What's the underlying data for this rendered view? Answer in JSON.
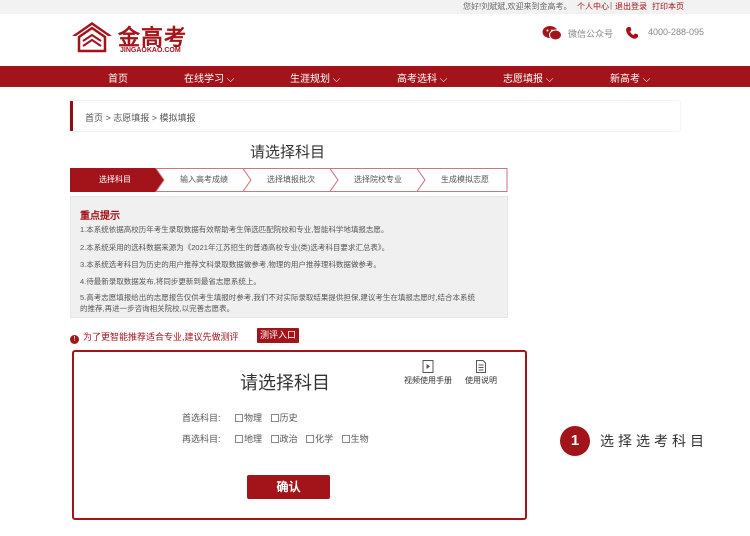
{
  "topbar": {
    "greeting": "您好!刘斌斌,欢迎来到金高考。",
    "user_center": "个人中心",
    "separator": "|",
    "logout": "退出登录",
    "print": "打印本页"
  },
  "logo": {
    "name": "金高考",
    "url": "JINGAOKAO.COM"
  },
  "contact": {
    "wechat": "微信公众号",
    "phone": "4000-288-095"
  },
  "nav": [
    {
      "label": "首页"
    },
    {
      "label": "在线学习 ⌵"
    },
    {
      "label": "生涯规划 ⌵"
    },
    {
      "label": "高考选科 ⌵"
    },
    {
      "label": "志愿填报 ⌵"
    },
    {
      "label": "新高考 ⌵"
    }
  ],
  "breadcrumb": "首页 > 志愿填报 > 模拟填报",
  "page_title": "请选择科目",
  "steps": [
    "选择科目",
    "输入高考成绩",
    "选择填报批次",
    "选择院校专业",
    "生成模拟志愿"
  ],
  "notice": {
    "heading": "重点提示",
    "lines": [
      "1.本系统依据高校历年考生录取数据有效帮助考生筛选匹配院校和专业,智能科学地填报志愿。",
      "2.本系统采用的选科数据来源为《2021年江苏招生的普通高校专业(类)选考科目要求汇总表》。",
      "3.本系统选考科目为历史的用户推荐文科录取数据做参考,物理的用户推荐理科数据做参考。",
      "4.待最新录取数据发布,将同步更新到最省志愿系统上。",
      "5.高考志愿填报给出的志愿报告仅供考生填报时参考,我们不对实际录取结果提供担保,建议考生在填报志愿时,结合本系统",
      "的推荐,再进一步咨询相关院校,以完善志愿表。"
    ]
  },
  "tip": {
    "icon": "!",
    "text": "为了更智能推荐适合专业,建议先做测评",
    "button": "测评入口"
  },
  "card": {
    "title": "请选择科目",
    "video_manual": "视频使用手册",
    "help": "使用说明",
    "first_label": "首选科目:",
    "first_options": [
      "物理",
      "历史"
    ],
    "second_label": "再选科目:",
    "second_options": [
      "地理",
      "政治",
      "化学",
      "生物"
    ],
    "confirm": "确认"
  },
  "annotation": {
    "number": "1",
    "text": "选择选考科目"
  },
  "colors": {
    "brand": "#a3141a",
    "panel_bg": "#f0f0f0"
  }
}
